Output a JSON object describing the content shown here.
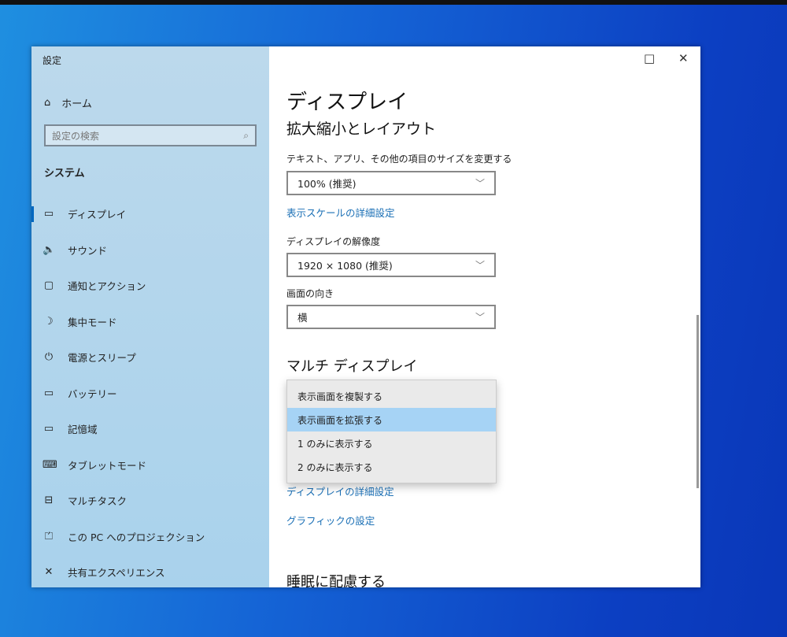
{
  "window": {
    "title": "設定",
    "maximize_icon": "□",
    "close_icon": "✕"
  },
  "sidebar": {
    "home": "ホーム",
    "search_placeholder": "設定の検索",
    "section": "システム",
    "items": [
      {
        "icon": "▭",
        "label": "ディスプレイ"
      },
      {
        "icon": "🔈",
        "label": "サウンド"
      },
      {
        "icon": "▢",
        "label": "通知とアクション"
      },
      {
        "icon": "☽",
        "label": "集中モード"
      },
      {
        "icon": "⏻",
        "label": "電源とスリープ"
      },
      {
        "icon": "▭",
        "label": "バッテリー"
      },
      {
        "icon": "▭",
        "label": "記憶域"
      },
      {
        "icon": "⌨",
        "label": "タブレットモード"
      },
      {
        "icon": "⊟",
        "label": "マルチタスク"
      },
      {
        "icon": "⏍",
        "label": "この PC へのプロジェクション"
      },
      {
        "icon": "✕",
        "label": "共有エクスペリエンス"
      }
    ]
  },
  "main": {
    "title": "ディスプレイ",
    "scale_heading": "拡大縮小とレイアウト",
    "size_label": "テキスト、アプリ、その他の項目のサイズを変更する",
    "size_value": "100% (推奨)",
    "scale_link": "表示スケールの詳細設定",
    "resolution_label": "ディスプレイの解像度",
    "resolution_value": "1920 × 1080 (推奨)",
    "orientation_label": "画面の向き",
    "orientation_value": "横",
    "multi_heading": "マルチ ディスプレイ",
    "multi_options": [
      "表示画面を複製する",
      "表示画面を拡張する",
      "1 のみに表示する",
      "2 のみに表示する"
    ],
    "multi_selected": "表示画面を拡張する",
    "advanced_link": "ディスプレイの詳細設定",
    "graphics_link": "グラフィックの設定",
    "sleep_heading": "睡眠に配慮する"
  }
}
